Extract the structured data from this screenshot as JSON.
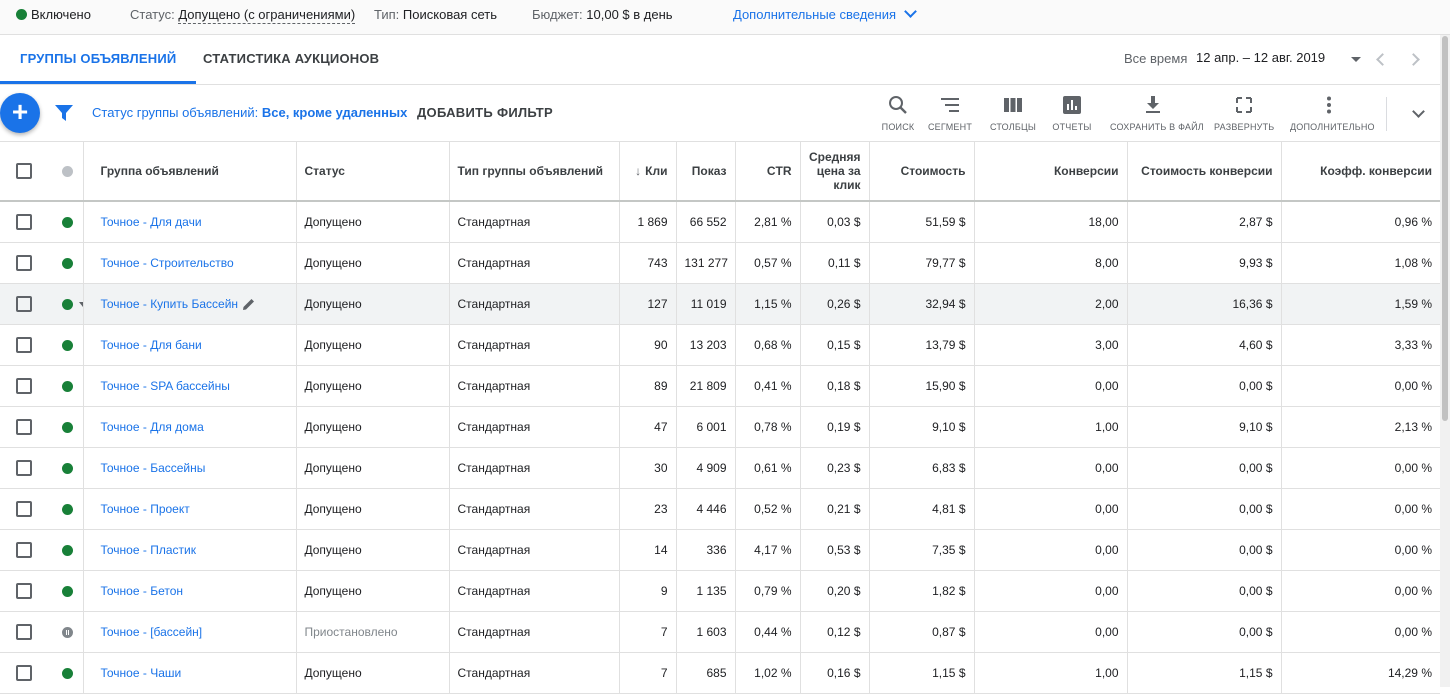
{
  "topbar": {
    "enabled_label": "Включено",
    "status_label": "Статус:",
    "status_value": "Допущено (с ограничениями)",
    "type_label": "Тип:",
    "type_value": "Поисковая сеть",
    "budget_label": "Бюджет:",
    "budget_value": "10,00 $ в день",
    "more_details": "Дополнительные сведения"
  },
  "tabs": [
    {
      "label": "ГРУППЫ ОБЪЯВЛЕНИЙ",
      "active": true
    },
    {
      "label": "СТАТИСТИКА АУКЦИОНОВ",
      "active": false
    }
  ],
  "date_range": {
    "label": "Все время",
    "value": "12 апр. – 12 авг. 2019"
  },
  "toolbar": {
    "add_button": "+",
    "filter_prefix": "Статус группы объявлений:",
    "filter_value": "Все, кроме удаленных",
    "add_filter": "ДОБАВИТЬ ФИЛЬТР",
    "tools": [
      {
        "label": "ПОИСК",
        "icon": "search-icon"
      },
      {
        "label": "СЕГМЕНТ",
        "icon": "segment-icon"
      },
      {
        "label": "СТОЛБЦЫ",
        "icon": "columns-icon"
      },
      {
        "label": "ОТЧЕТЫ",
        "icon": "reports-icon"
      },
      {
        "label": "СОХРАНИТЬ В ФАЙЛ",
        "icon": "download-icon"
      },
      {
        "label": "РАЗВЕРНУТЬ",
        "icon": "fullscreen-icon"
      },
      {
        "label": "ДОПОЛНИТЕЛЬНО",
        "icon": "more-vert-icon"
      }
    ]
  },
  "table": {
    "columns": [
      "Группа объявлений",
      "Статус",
      "Тип группы объявлений",
      "Кли",
      "Показ",
      "CTR",
      "Средняя цена за клик",
      "Стоимость",
      "Конверсии",
      "Стоимость конверсии",
      "Коэфф. конверсии"
    ],
    "rows": [
      {
        "name": "Точное - Для дачи",
        "state": "enabled",
        "status": "Допущено",
        "type": "Стандартная",
        "clicks": "1 869",
        "impr": "66 552",
        "ctr": "2,81 %",
        "cpc": "0,03 $",
        "cost": "51,59 $",
        "conv": "18,00",
        "cost_conv": "2,87 $",
        "conv_rate": "0,96 %"
      },
      {
        "name": "Точное - Строительство",
        "state": "enabled",
        "status": "Допущено",
        "type": "Стандартная",
        "clicks": "743",
        "impr": "131 277",
        "ctr": "0,57 %",
        "cpc": "0,11 $",
        "cost": "79,77 $",
        "conv": "8,00",
        "cost_conv": "9,93 $",
        "conv_rate": "1,08 %"
      },
      {
        "name": "Точное - Купить Бассейн",
        "state": "enabled",
        "status": "Допущено",
        "type": "Стандартная",
        "clicks": "127",
        "impr": "11 019",
        "ctr": "1,15 %",
        "cpc": "0,26 $",
        "cost": "32,94 $",
        "conv": "2,00",
        "cost_conv": "16,36 $",
        "conv_rate": "1,59 %",
        "highlighted": true
      },
      {
        "name": "Точное - Для бани",
        "state": "enabled",
        "status": "Допущено",
        "type": "Стандартная",
        "clicks": "90",
        "impr": "13 203",
        "ctr": "0,68 %",
        "cpc": "0,15 $",
        "cost": "13,79 $",
        "conv": "3,00",
        "cost_conv": "4,60 $",
        "conv_rate": "3,33 %"
      },
      {
        "name": "Точное - SPA бассейны",
        "state": "enabled",
        "status": "Допущено",
        "type": "Стандартная",
        "clicks": "89",
        "impr": "21 809",
        "ctr": "0,41 %",
        "cpc": "0,18 $",
        "cost": "15,90 $",
        "conv": "0,00",
        "cost_conv": "0,00 $",
        "conv_rate": "0,00 %"
      },
      {
        "name": "Точное - Для дома",
        "state": "enabled",
        "status": "Допущено",
        "type": "Стандартная",
        "clicks": "47",
        "impr": "6 001",
        "ctr": "0,78 %",
        "cpc": "0,19 $",
        "cost": "9,10 $",
        "conv": "1,00",
        "cost_conv": "9,10 $",
        "conv_rate": "2,13 %"
      },
      {
        "name": "Точное - Бассейны",
        "state": "enabled",
        "status": "Допущено",
        "type": "Стандартная",
        "clicks": "30",
        "impr": "4 909",
        "ctr": "0,61 %",
        "cpc": "0,23 $",
        "cost": "6,83 $",
        "conv": "0,00",
        "cost_conv": "0,00 $",
        "conv_rate": "0,00 %"
      },
      {
        "name": "Точное - Проект",
        "state": "enabled",
        "status": "Допущено",
        "type": "Стандартная",
        "clicks": "23",
        "impr": "4 446",
        "ctr": "0,52 %",
        "cpc": "0,21 $",
        "cost": "4,81 $",
        "conv": "0,00",
        "cost_conv": "0,00 $",
        "conv_rate": "0,00 %"
      },
      {
        "name": "Точное - Пластик",
        "state": "enabled",
        "status": "Допущено",
        "type": "Стандартная",
        "clicks": "14",
        "impr": "336",
        "ctr": "4,17 %",
        "cpc": "0,53 $",
        "cost": "7,35 $",
        "conv": "0,00",
        "cost_conv": "0,00 $",
        "conv_rate": "0,00 %"
      },
      {
        "name": "Точное - Бетон",
        "state": "enabled",
        "status": "Допущено",
        "type": "Стандартная",
        "clicks": "9",
        "impr": "1 135",
        "ctr": "0,79 %",
        "cpc": "0,20 $",
        "cost": "1,82 $",
        "conv": "0,00",
        "cost_conv": "0,00 $",
        "conv_rate": "0,00 %"
      },
      {
        "name": "Точное - [бассейн]",
        "state": "paused",
        "status": "Приостановлено",
        "type": "Стандартная",
        "clicks": "7",
        "impr": "1 603",
        "ctr": "0,44 %",
        "cpc": "0,12 $",
        "cost": "0,87 $",
        "conv": "0,00",
        "cost_conv": "0,00 $",
        "conv_rate": "0,00 %"
      },
      {
        "name": "Точное - Чаши",
        "state": "enabled",
        "status": "Допущено",
        "type": "Стандартная",
        "clicks": "7",
        "impr": "685",
        "ctr": "1,02 %",
        "cpc": "0,16 $",
        "cost": "1,15 $",
        "conv": "1,00",
        "cost_conv": "1,15 $",
        "conv_rate": "14,29 %"
      }
    ]
  },
  "colors": {
    "accent": "#1a73e8",
    "enabled": "#188038",
    "paused": "#80868b"
  }
}
